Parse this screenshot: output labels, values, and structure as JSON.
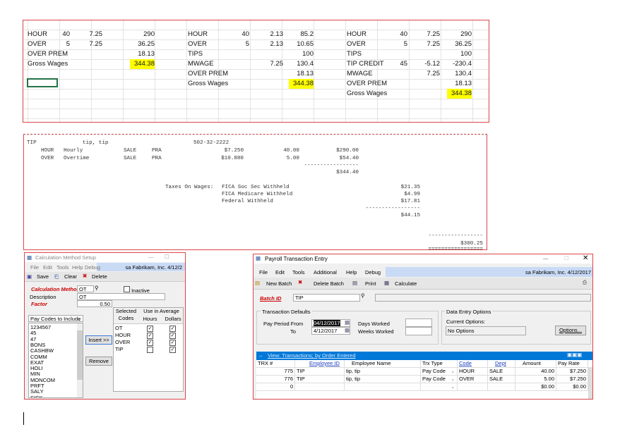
{
  "spreadsheet": {
    "block1": [
      [
        "HOUR",
        "40",
        "7.25",
        "290"
      ],
      [
        "OVER",
        "5",
        "7.25",
        "36.25"
      ],
      [
        "OVER PREM",
        "",
        "",
        "18.13"
      ],
      [
        "Gross Wages",
        "",
        "",
        "344.38"
      ]
    ],
    "block2": [
      [
        "HOUR",
        "40",
        "2.13",
        "85.2"
      ],
      [
        "OVER",
        "5",
        "2.13",
        "10.65"
      ],
      [
        "TIPS",
        "",
        "",
        "100"
      ],
      [
        "MWAGE",
        "",
        "7.25",
        "130.4"
      ],
      [
        "OVER PREM",
        "",
        "",
        "18.13"
      ],
      [
        "Gross Wages",
        "",
        "",
        "344.38"
      ]
    ],
    "block3": [
      [
        "HOUR",
        "40",
        "7.25",
        "290"
      ],
      [
        "OVER",
        "5",
        "7.25",
        "36.25"
      ],
      [
        "TIPS",
        "",
        "",
        "100"
      ],
      [
        "TIP CREDIT",
        "45",
        "-5.12",
        "-230.4"
      ],
      [
        "MWAGE",
        "",
        "7.25",
        "130.4"
      ],
      [
        "OVER PREM",
        "",
        "",
        "18.13"
      ],
      [
        "Gross Wages",
        "",
        "",
        "344.38"
      ]
    ],
    "highlight_color": "#ffff00"
  },
  "report": {
    "employee_id": "TIP",
    "employee_name": "tip, tip",
    "ssn": "502-32-2222",
    "lines": [
      [
        "HOUR",
        "Hourly",
        "SALE",
        "PRA",
        "$7.250",
        "40.00",
        "$290.00"
      ],
      [
        "OVER",
        "Overtime",
        "SALE",
        "PRA",
        "$10.880",
        "5.00",
        "$54.40"
      ]
    ],
    "dashes": "-----------------",
    "gross": "$344.40",
    "taxes_label": "Taxes On Wages:",
    "taxes": [
      [
        "FICA Soc Sec Withheld",
        "$21.35"
      ],
      [
        "FICA Medicare Withheld",
        "$4.99"
      ],
      [
        "Federal Withheld",
        "$17.81"
      ]
    ],
    "tax_total": "$44.15",
    "net": "$300.25",
    "double_line": "================="
  },
  "calc_window": {
    "title": "Calculation Method Setup",
    "menu": [
      "File",
      "Edit",
      "Tools",
      "Help",
      "Debug"
    ],
    "company": "sa  Fabrikam, Inc.  4/12/2",
    "toolbar": [
      "Save",
      "Clear",
      "Delete"
    ],
    "calc_method_label": "Calculation Method",
    "calc_method": "OT",
    "inactive_label": "Inactive",
    "description_label": "Description",
    "description": "OT",
    "factor_label": "Factor",
    "factor": "0.50",
    "pay_codes_dropdown": "Pay Codes to Include",
    "pay_codes": [
      "1234567",
      "45",
      "47",
      "BONS",
      "CASHBW",
      "COMM",
      "EXAT",
      "HOLI",
      "MIN",
      "MONCOM",
      "PRFT",
      "SALY",
      "SICK"
    ],
    "insert_label": "Insert >>",
    "remove_label": "Remove",
    "headers": {
      "selected": "Selected",
      "codes": "Codes",
      "use_avg": "Use in Average",
      "hours": "Hours",
      "dollars": "Dollars"
    },
    "selected": [
      {
        "code": "OT",
        "hours": true,
        "dollars": true
      },
      {
        "code": "HOUR",
        "hours": true,
        "dollars": true
      },
      {
        "code": "OVER",
        "hours": true,
        "dollars": true
      },
      {
        "code": "TIP",
        "hours": false,
        "dollars": true
      }
    ]
  },
  "payroll_window": {
    "title": "Payroll Transaction Entry",
    "menu": [
      "File",
      "Edit",
      "Tools",
      "Additional",
      "Help",
      "Debug"
    ],
    "company": "sa  Fabrikam, Inc.  4/12/2017",
    "toolbar": [
      "New Batch",
      "Delete Batch",
      "Print",
      "Calculate"
    ],
    "batch_label": "Batch ID",
    "batch_id": "TIP",
    "trx_defaults": "Transaction Defaults",
    "pay_from_label": "Pay Period From",
    "pay_from": "04/12/2017",
    "to_label": "To",
    "pay_to": "4/12/2017",
    "days_label": "Days Worked",
    "weeks_label": "Weeks Worked",
    "data_entry": "Data Entry Options",
    "current_options": "Current Options:",
    "no_options": "No Options",
    "options_btn": "Options...",
    "view_label": "View: Transactions; by Order Entered",
    "columns": [
      "TRX #",
      "Employee ID",
      "Employee Name",
      "Trx Type",
      "Code",
      "Dept",
      "Amount",
      "Pay Rate"
    ],
    "rows": [
      [
        "775",
        "TIP",
        "tip, tip",
        "Pay Code",
        "HOUR",
        "SALE",
        "40.00",
        "$7.250"
      ],
      [
        "776",
        "TIP",
        "tip, tip",
        "Pay Code",
        "OVER",
        "SALE",
        "5.00",
        "$7.250"
      ],
      [
        "0",
        "",
        "",
        "",
        "",
        "",
        "$0.00",
        "$0.00"
      ]
    ],
    "accent": "#0078d7"
  }
}
